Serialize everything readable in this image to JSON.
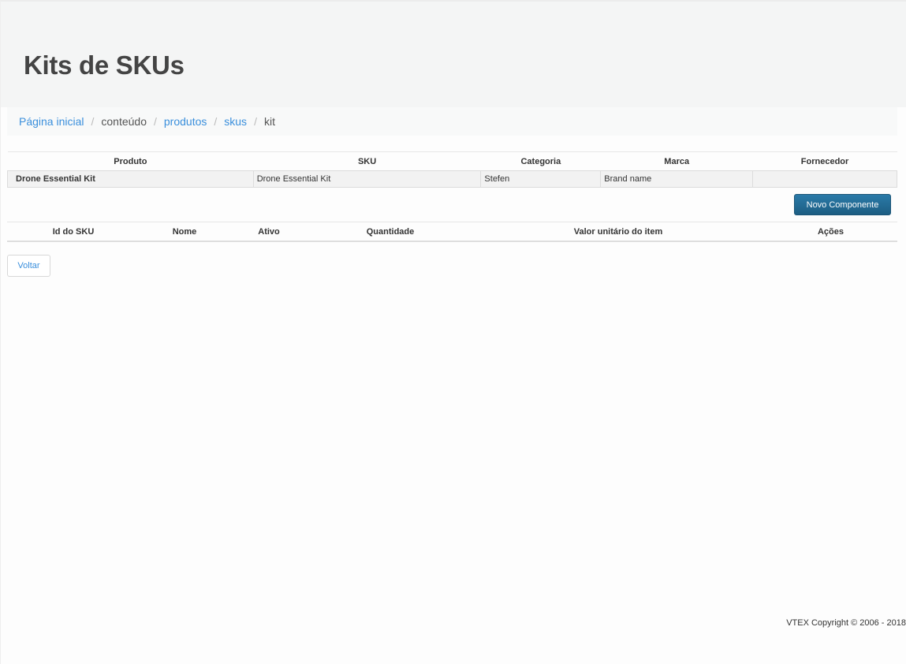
{
  "header": {
    "title": "Kits de SKUs"
  },
  "breadcrumb": {
    "home": "Página inicial",
    "content": "conteúdo",
    "products": "produtos",
    "skus": "skus",
    "current": "kit",
    "separator": "/"
  },
  "kit_table": {
    "columns": [
      "Produto",
      "SKU",
      "Categoria",
      "Marca",
      "Fornecedor"
    ],
    "rows": [
      [
        "Drone Essential Kit",
        "Drone Essential Kit",
        "Stefen",
        "Brand name",
        ""
      ]
    ]
  },
  "actions": {
    "new_component": "Novo Componente",
    "back": "Voltar"
  },
  "components_table": {
    "columns": [
      "Id do SKU",
      "Nome",
      "Ativo",
      "Quantidade",
      "Valor unitário do item",
      "Ações"
    ],
    "rows": []
  },
  "footer": {
    "copyright": "VTEX Copyright © 2006 - 2018"
  },
  "colors": {
    "link": "#3a8fdc",
    "primary_button": "#1d5e83",
    "header_bg": "#f4f5f5"
  }
}
